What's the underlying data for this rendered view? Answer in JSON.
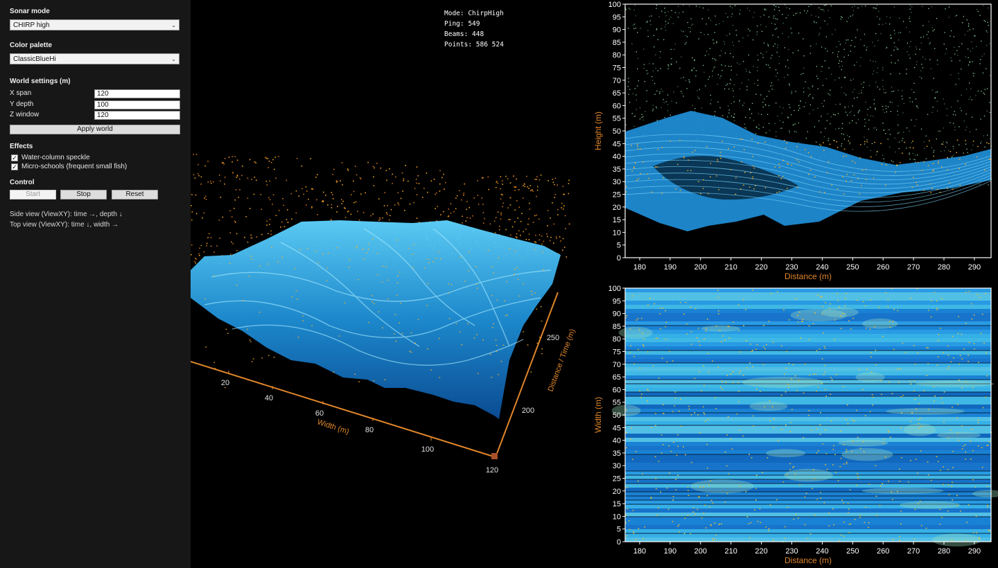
{
  "sidebar": {
    "sonar_mode": {
      "label": "Sonar mode",
      "value": "CHIRP high"
    },
    "color_palette": {
      "label": "Color palette",
      "value": "ClassicBlueHi"
    },
    "world_settings": {
      "label": "World settings (m)",
      "fields": [
        {
          "label": "X span",
          "value": "120"
        },
        {
          "label": "Y depth",
          "value": "100"
        },
        {
          "label": "Z window",
          "value": "120"
        }
      ],
      "apply_label": "Apply world"
    },
    "effects": {
      "label": "Effects",
      "options": [
        {
          "label": "Water-column speckle",
          "checked": true
        },
        {
          "label": "Micro-schools (frequent small fish)",
          "checked": true
        }
      ]
    },
    "control": {
      "label": "Control",
      "start_label": "Start",
      "stop_label": "Stop",
      "reset_label": "Reset",
      "start_enabled": false
    },
    "hints": [
      "Side view (ViewXY): time →, depth ↓",
      "Top view (ViewXY): time ↓, width →"
    ]
  },
  "status": {
    "mode": "Mode: ChirpHigh",
    "ping": "Ping:  549",
    "beams": "Beams: 448",
    "points": "Points: 586 524"
  },
  "view3d": {
    "width_axis": {
      "label": "Width (m)",
      "ticks": [
        "20",
        "40",
        "60",
        "80",
        "100",
        "120"
      ]
    },
    "distance_axis": {
      "label": "Distance / Time (m)",
      "ticks": [
        "200",
        "250"
      ]
    }
  },
  "side_view": {
    "xlabel": "Distance (m)",
    "ylabel": "Height (m)",
    "xticks": [
      "180",
      "190",
      "200",
      "210",
      "220",
      "230",
      "240",
      "250",
      "260",
      "270",
      "280",
      "290"
    ],
    "yticks": [
      "0",
      "5",
      "10",
      "15",
      "20",
      "25",
      "30",
      "35",
      "40",
      "45",
      "50",
      "55",
      "60",
      "65",
      "70",
      "75",
      "80",
      "85",
      "90",
      "95",
      "100"
    ]
  },
  "top_view": {
    "xlabel": "Distance (m)",
    "ylabel": "Width (m)",
    "xticks": [
      "180",
      "190",
      "200",
      "210",
      "220",
      "230",
      "240",
      "250",
      "260",
      "270",
      "280",
      "290"
    ],
    "yticks": [
      "0",
      "5",
      "10",
      "15",
      "20",
      "25",
      "30",
      "35",
      "40",
      "45",
      "50",
      "55",
      "60",
      "65",
      "70",
      "75",
      "80",
      "85",
      "90",
      "95",
      "100"
    ]
  },
  "colors": {
    "panel_bg": "#171717",
    "axis_orange": "#e0862a",
    "seafloor_blue": "#2aa9e8",
    "speckle_orange": "#f0a020"
  }
}
